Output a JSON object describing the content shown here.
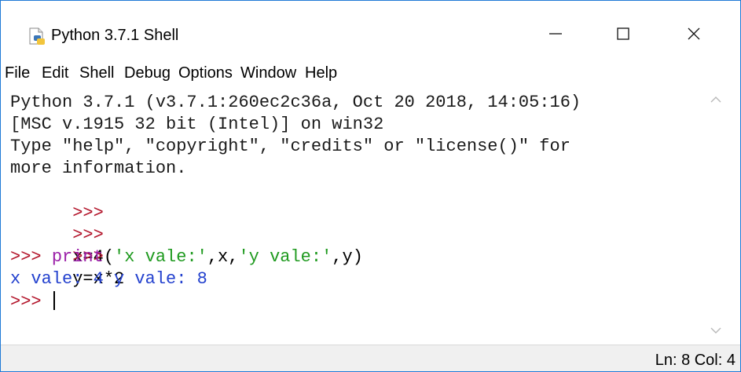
{
  "window": {
    "title": "Python 3.7.1 Shell",
    "icon": "python-idle-icon"
  },
  "controls": {
    "minimize_icon": "minimize-icon",
    "maximize_icon": "maximize-icon",
    "close_icon": "close-icon"
  },
  "menu": {
    "items": [
      "File",
      "Edit",
      "Shell",
      "Debug",
      "Options",
      "Window",
      "Help"
    ]
  },
  "shell": {
    "banner": [
      "Python 3.7.1 (v3.7.1:260ec2c36a, Oct 20 2018, 14:05:16)",
      "[MSC v.1915 32 bit (Intel)] on win32",
      "Type \"help\", \"copyright\", \"credits\" or \"license()\" for",
      "more information."
    ],
    "prompt": ">>>",
    "inputs": [
      {
        "code": "x=4"
      },
      {
        "code": "y=x*2"
      },
      {
        "builtin": "print",
        "open_paren": "(",
        "str1": "'x vale:'",
        "mid1": ",x,",
        "str2": "'y vale:'",
        "mid2": ",y)"
      }
    ],
    "output": "x vale: 4 y vale: 8"
  },
  "status": {
    "text": "Ln: 8 Col: 4"
  },
  "colors": {
    "prompt": "#b3152b",
    "builtin": "#9b1fa8",
    "string": "#1f9a1f",
    "output": "#2341ce",
    "window_border": "#1f7ad6"
  }
}
